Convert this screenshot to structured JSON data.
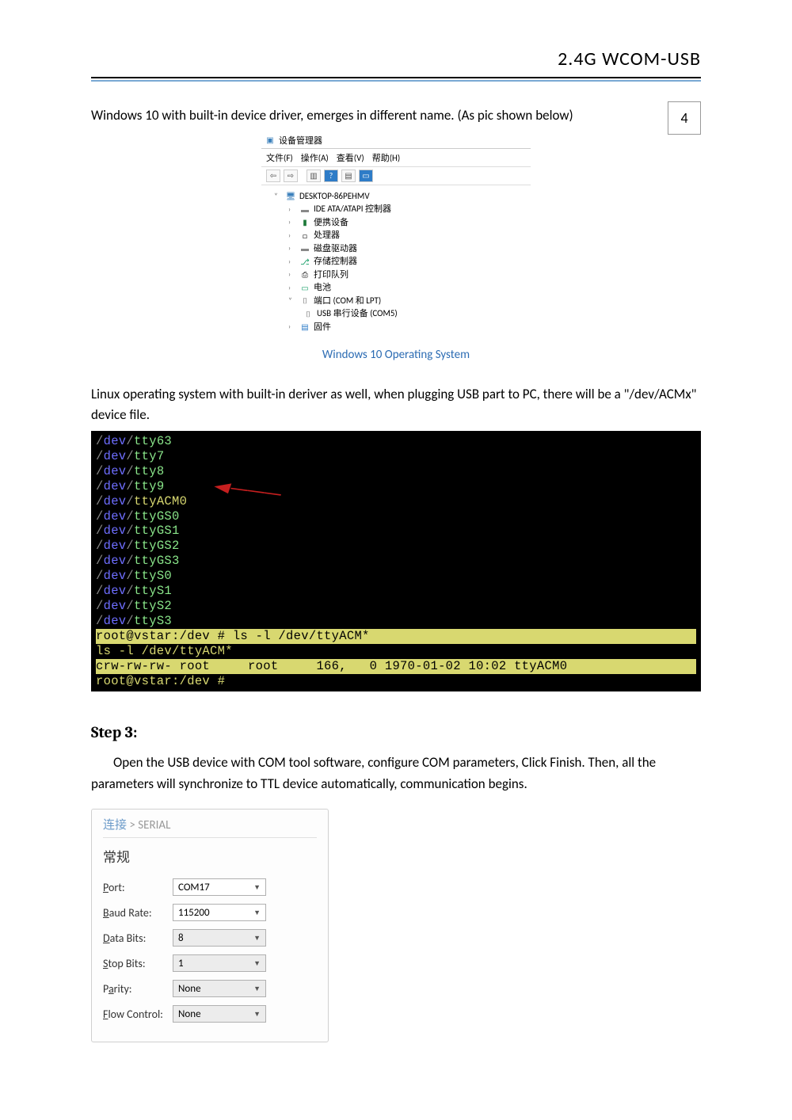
{
  "header": {
    "title": "2.4G  WCOM-USB",
    "page_number": "4"
  },
  "intro1": "Windows 10 with built-in device driver, emerges in different name. (As pic shown below)",
  "device_manager": {
    "window_title": "设备管理器",
    "menu": {
      "file": "文件(F)",
      "action": "操作(A)",
      "view": "查看(V)",
      "help": "帮助(H)"
    },
    "root": "DESKTOP-86PEHMV",
    "items": [
      "IDE ATA/ATAPI 控制器",
      "便携设备",
      "处理器",
      "磁盘驱动器",
      "存储控制器",
      "打印队列",
      "电池"
    ],
    "ports_label": "端口 (COM 和 LPT)",
    "ports_child": "USB 串行设备 (COM5)",
    "firmware": "固件",
    "caption": "Windows 10 Operating System"
  },
  "intro2": "Linux operating system with built-in deriver as well, when plugging USB part to PC, there will be a \"/dev/ACMx\" device file.",
  "terminal": {
    "lines": [
      "/dev/tty63",
      "/dev/tty7",
      "/dev/tty8",
      "/dev/tty9",
      "/dev/ttyACM0",
      "/dev/ttyGS0",
      "/dev/ttyGS1",
      "/dev/ttyGS2",
      "/dev/ttyGS3",
      "/dev/ttyS0",
      "/dev/ttyS1",
      "/dev/ttyS2",
      "/dev/ttyS3"
    ],
    "cmd1": "root@vstar:/dev # ls -l /dev/ttyACM*",
    "ls_echo": "ls -l /dev/ttyACM*",
    "listing": "crw-rw-rw- root     root     166,   0 1970-01-02 10:02 ttyACM0",
    "prompt2": "root@vstar:/dev #"
  },
  "step3": {
    "heading": "Step 3:",
    "body": "Open the USB device with COM tool software, configure COM parameters, Click Finish. Then, all the parameters will synchronize to TTL device automatically, communication begins."
  },
  "serial": {
    "breadcrumb_link": "连接",
    "breadcrumb_sep": " > ",
    "breadcrumb_cur": "SERIAL",
    "section": "常规",
    "fields": {
      "port_label": "Port:",
      "port_value": "COM17",
      "baud_label": "Baud Rate:",
      "baud_value": "115200",
      "data_label": "Data Bits:",
      "data_value": "8",
      "stop_label": "Stop Bits:",
      "stop_value": "1",
      "parity_label": "Parity:",
      "parity_value": "None",
      "flow_label": "Flow Control:",
      "flow_value": "None"
    }
  }
}
